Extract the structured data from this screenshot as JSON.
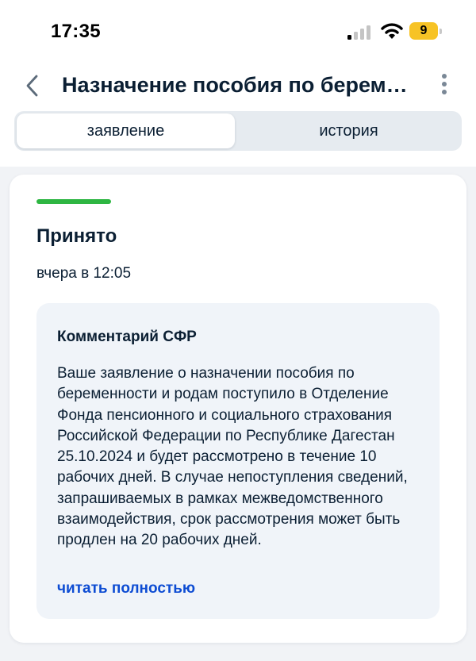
{
  "status_bar": {
    "time": "17:35",
    "battery_level": "9",
    "battery_color": "#f7c325",
    "signal_icon": "cellular-signal-icon",
    "wifi_icon": "wifi-icon",
    "battery_icon": "battery-icon"
  },
  "header": {
    "title": "Назначение пособия по беременности и родам",
    "back_icon": "chevron-left-icon",
    "menu_icon": "more-vertical-icon"
  },
  "tabs": [
    {
      "label": "заявление",
      "active": true
    },
    {
      "label": "история",
      "active": false
    }
  ],
  "status_card": {
    "status": "Принято",
    "status_color": "#2eb642",
    "date": "вчера в 12:05",
    "comment": {
      "heading": "Комментарий СФР",
      "text": "Ваше заявление о назначении пособия по беременности и родам поступило в Отделение Фонда пенсионного и социального страхования Российской Федерации по Республике Дагестан 25.10.2024 и будет рассмотрено в течение 10 рабочих дней. В случае непоступления сведений, запрашиваемых в рамках межведомственного взаимодействия, срок рассмотрения может быть продлен на 20 рабочих дней.",
      "read_more": "читать полностью",
      "link_color": "#0d4cd3"
    }
  }
}
